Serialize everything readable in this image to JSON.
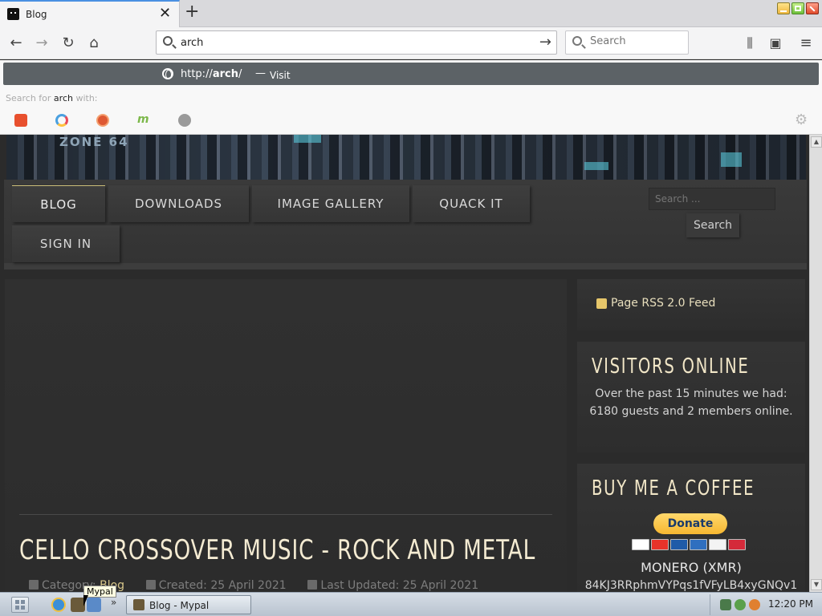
{
  "browser": {
    "tab": {
      "title": "Blog"
    },
    "url": "arch",
    "search_placeholder": "Search",
    "suggestion": {
      "url_prefix": "http://",
      "url_bold": "arch",
      "url_suffix": "/",
      "separator": "—",
      "action": "Visit"
    },
    "search_for": {
      "prefix": "Search for",
      "query": "arch",
      "suffix": "with:"
    },
    "engines": [
      "brave-icon",
      "qwant-icon",
      "duckduckgo-icon",
      "mojeek-icon",
      "search-engine-icon"
    ]
  },
  "site": {
    "banner_text": "ZONE 64",
    "menu": [
      "BLOG",
      "DOWNLOADS",
      "IMAGE GALLERY",
      "QUACK IT",
      "SIGN IN"
    ],
    "search_placeholder": "Search ...",
    "search_button": "Search"
  },
  "article": {
    "title": "CELLO CROSSOVER MUSIC - ROCK AND METAL",
    "category_label": "Category:",
    "category_value": "Blog",
    "created": "Created: 25 April 2021",
    "updated": "Last Updated: 25 April 2021"
  },
  "sidebar": {
    "rss": "Page RSS 2.0 Feed",
    "visitors_title": "VISITORS ONLINE",
    "visitors_text": "Over the past 15 minutes we had: 6180 guests and 2 members online.",
    "coffee_title": "BUY ME A COFFEE",
    "donate": "Donate",
    "monero": "MONERO (XMR)",
    "address": "84KJ3RRphmVYPqs1fVFyLB4xyGNQv1"
  },
  "taskbar": {
    "task": "Blog - Mypal",
    "tooltip": "Mypal",
    "clock": "12:20 PM"
  },
  "colors": {
    "accent_gold": "#f1e6c7",
    "link_gold": "#d8c78a",
    "donate_yellow": "#f6b731",
    "url_highlight": "#5c6266"
  }
}
